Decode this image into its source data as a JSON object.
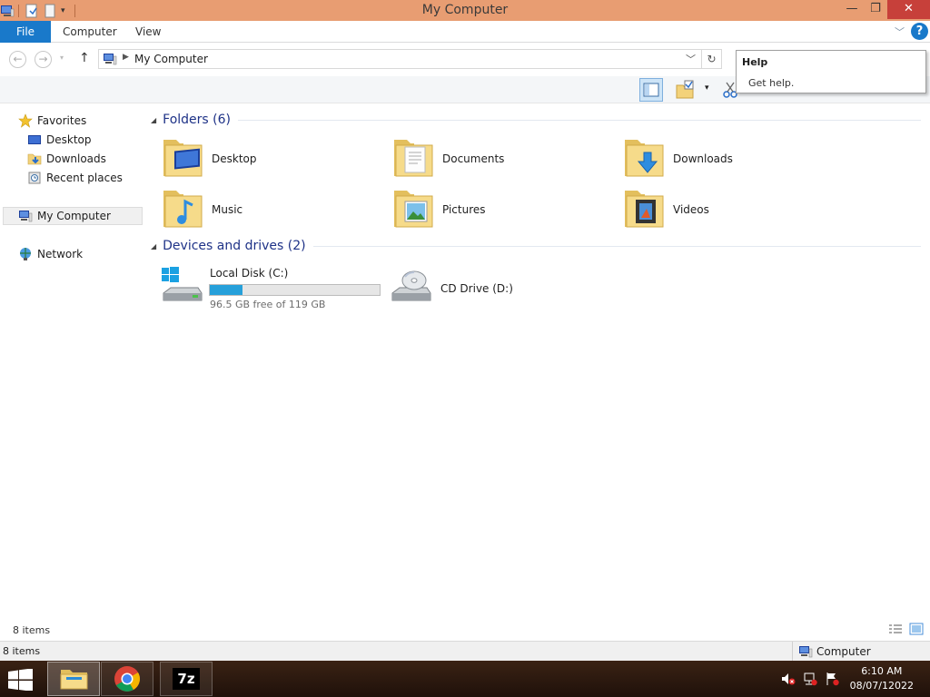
{
  "window": {
    "title": "My Computer",
    "controls": {
      "minimize": "—",
      "maximize": "❐",
      "close": "✕"
    }
  },
  "ribbon": {
    "tabs": [
      "File",
      "Computer",
      "View"
    ],
    "help": "?"
  },
  "address": {
    "path": "My Computer"
  },
  "tooltip": {
    "title": "Help",
    "body": "Get help."
  },
  "navpane": {
    "favorites": "Favorites",
    "desktop": "Desktop",
    "downloads": "Downloads",
    "recent": "Recent places",
    "my_computer": "My Computer",
    "network": "Network"
  },
  "groups": {
    "folders": "Folders (6)",
    "devices": "Devices and drives (2)"
  },
  "folders": [
    {
      "name": "Desktop",
      "icon": "desktop-folder-icon"
    },
    {
      "name": "Documents",
      "icon": "documents-folder-icon"
    },
    {
      "name": "Downloads",
      "icon": "downloads-folder-icon"
    },
    {
      "name": "Music",
      "icon": "music-folder-icon"
    },
    {
      "name": "Pictures",
      "icon": "pictures-folder-icon"
    },
    {
      "name": "Videos",
      "icon": "videos-folder-icon"
    }
  ],
  "drives": [
    {
      "name": "Local Disk (C:)",
      "free_text": "96.5 GB free of 119 GB",
      "used_fraction": 0.19
    },
    {
      "name": "CD Drive (D:)"
    }
  ],
  "status": {
    "items_top": "8 items",
    "items_bottom": "8 items",
    "location": "Computer"
  },
  "taskbar": {
    "apps": [
      "file-explorer-icon",
      "chrome-icon",
      "7zip-icon"
    ],
    "sevenzip_label": "7z",
    "time": "6:10 AM",
    "date": "08/07/12022"
  },
  "colors": {
    "titlebar": "#e89d72",
    "accent": "#1979ca",
    "close": "#c7403a",
    "progress": "#26a0da"
  }
}
